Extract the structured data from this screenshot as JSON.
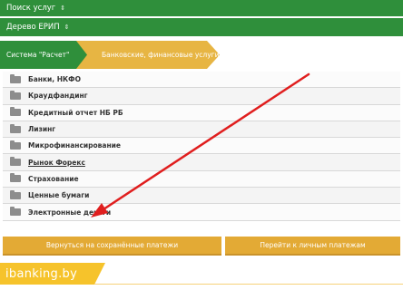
{
  "search_bar": {
    "label": "Поиск услуг",
    "caret": "⇕"
  },
  "tree_bar": {
    "label": "Дерево ЕРИП",
    "caret": "⇕"
  },
  "breadcrumb": [
    {
      "label": "Система \"Расчет\""
    },
    {
      "label": "Банковские, финансовые услуги"
    }
  ],
  "categories": [
    {
      "label": "Банки, НКФО"
    },
    {
      "label": "Краудфандинг"
    },
    {
      "label": "Кредитный отчет НБ РБ"
    },
    {
      "label": "Лизинг"
    },
    {
      "label": "Микрофинансирование"
    },
    {
      "label": "Рынок Форекс"
    },
    {
      "label": "Страхование"
    },
    {
      "label": "Ценные бумаги"
    },
    {
      "label": "Электронные деньги"
    }
  ],
  "buttons": {
    "saved_payments": "Вернуться на сохранённые платежи",
    "personal_payments": "Перейти к личным платежам"
  },
  "watermark": {
    "text": "ibanking.by"
  },
  "icons": {
    "folder": "folder-icon",
    "caret": "caret-updown-icon",
    "annotation": "red-arrow"
  },
  "colors": {
    "green": "#2f8f3b",
    "orange": "#e3aa35",
    "arrow": "#e01e1e",
    "watermark": "#f6c32b"
  }
}
